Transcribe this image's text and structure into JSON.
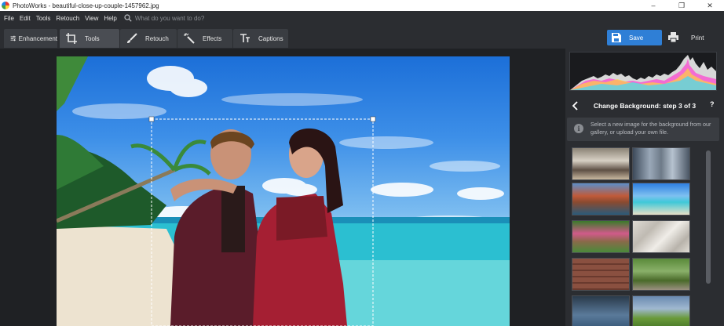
{
  "window": {
    "title": "PhotoWorks - beautiful-close-up-couple-1457962.jpg",
    "controls": [
      "–",
      "❐",
      "✕"
    ]
  },
  "menu": {
    "items": [
      "File",
      "Edit",
      "Tools",
      "Retouch",
      "View",
      "Help"
    ],
    "search_placeholder": "What do you want to do?"
  },
  "toolbar": {
    "tabs": [
      {
        "label": "Enhancement",
        "icon": "sliders-icon"
      },
      {
        "label": "Tools",
        "icon": "crop-icon",
        "active": true
      },
      {
        "label": "Retouch",
        "icon": "brush-icon"
      },
      {
        "label": "Effects",
        "icon": "magic-wand-icon"
      },
      {
        "label": "Captions",
        "icon": "text-icon"
      }
    ],
    "save_label": "Save",
    "print_label": "Print"
  },
  "panel": {
    "step_title": "Change Background: step 3 of 3",
    "help": "?",
    "info_text": "Select a new image for the background from our gallery, or upload your own file.",
    "thumbnails": [
      "living-room",
      "city-street",
      "canal-town",
      "tropical-beach",
      "garden-path",
      "crumpled-paper",
      "brick-wall",
      "park-bridge",
      "stormy-sea",
      "rainbow-field"
    ]
  },
  "colors": {
    "accent": "#2f7fd6",
    "background": "#1f2124",
    "panel": "#2b2d31"
  }
}
